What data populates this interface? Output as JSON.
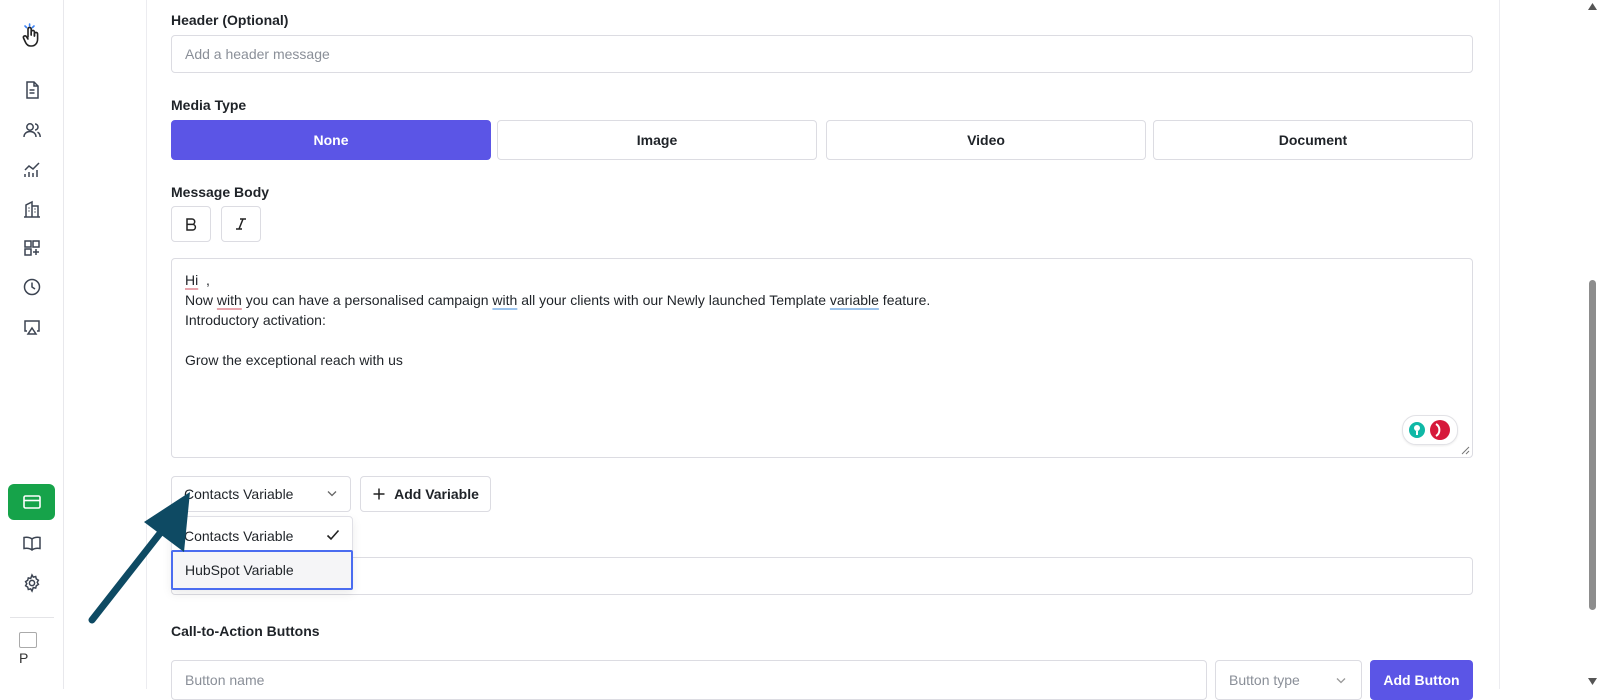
{
  "header": {
    "label": "Header (Optional)",
    "placeholder": "Add a header message"
  },
  "media": {
    "label": "Media Type",
    "options": [
      "None",
      "Image",
      "Video",
      "Document"
    ],
    "selected": "None"
  },
  "message_body": {
    "label": "Message Body",
    "lines": [
      "Hi  ,",
      "Now with you can have a personalised campaign with all your clients with our Newly launched Template variable feature.",
      "Introductory activation:",
      "",
      "Grow the exceptional reach with us"
    ]
  },
  "variables": {
    "select_value": "Contacts Variable",
    "add_label": "Add Variable",
    "options": [
      "Contacts Variable",
      "HubSpot Variable"
    ],
    "checked": "Contacts Variable",
    "highlighted": "HubSpot Variable"
  },
  "cta": {
    "label": "Call-to-Action Buttons",
    "name_placeholder": "Button name",
    "type_placeholder": "Button type",
    "add_label": "Add Button"
  },
  "colors": {
    "primary": "#5b55e6",
    "sidebar_active": "#16a34a",
    "annotation_arrow": "#0e4a63",
    "focus_ring": "#4a6cf0"
  },
  "sidebar": {
    "icons": [
      "logo-hand-icon",
      "document-icon",
      "contacts-icon",
      "analytics-icon",
      "building-icon",
      "add-widget-icon",
      "clock-icon",
      "broadcast-icon",
      "card-icon",
      "book-icon",
      "settings-icon"
    ],
    "active": "card-icon",
    "avatar_letter": "P"
  }
}
